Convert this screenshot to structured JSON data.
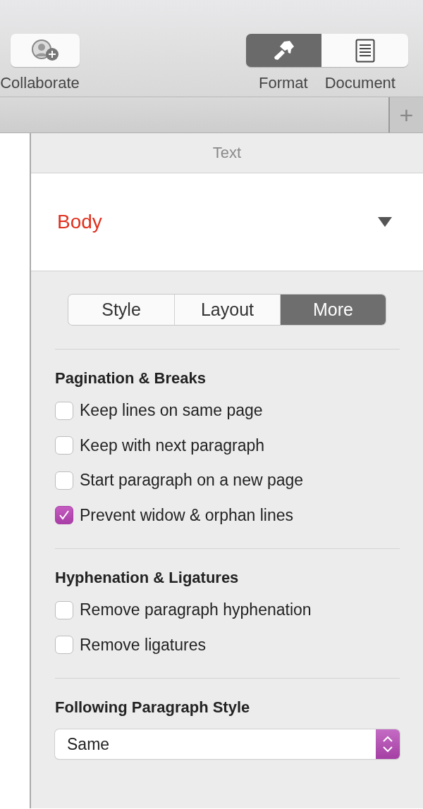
{
  "toolbar": {
    "collaborate": {
      "label": "Collaborate"
    },
    "views": [
      {
        "label": "Format",
        "selected": true
      },
      {
        "label": "Document",
        "selected": false
      }
    ]
  },
  "tab_bar": {
    "add_button": "+"
  },
  "panel": {
    "title": "Text",
    "paragraph_style": {
      "name": "Body",
      "color": "#e0301e"
    },
    "tabs": [
      {
        "label": "Style",
        "selected": false
      },
      {
        "label": "Layout",
        "selected": false
      },
      {
        "label": "More",
        "selected": true
      }
    ],
    "sections": [
      {
        "title": "Pagination & Breaks",
        "options": [
          {
            "label": "Keep lines on same page",
            "checked": false
          },
          {
            "label": "Keep with next paragraph",
            "checked": false
          },
          {
            "label": "Start paragraph on a new page",
            "checked": false
          },
          {
            "label": "Prevent widow & orphan lines",
            "checked": true
          }
        ]
      },
      {
        "title": "Hyphenation & Ligatures",
        "options": [
          {
            "label": "Remove paragraph hyphenation",
            "checked": false
          },
          {
            "label": "Remove ligatures",
            "checked": false
          }
        ]
      },
      {
        "title": "Following Paragraph Style",
        "select": {
          "value": "Same"
        }
      }
    ]
  }
}
